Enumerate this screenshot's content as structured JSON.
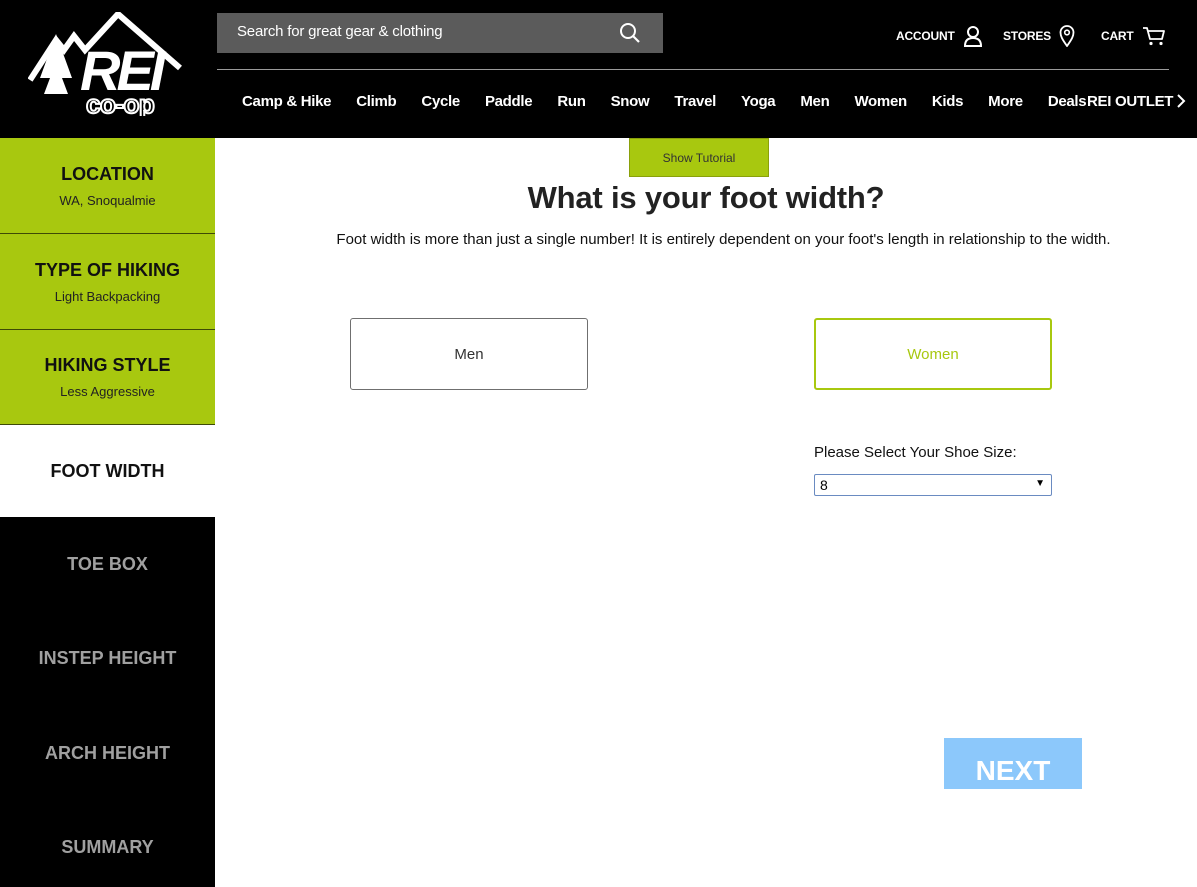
{
  "header": {
    "search_placeholder": "Search for great gear & clothing",
    "account_label": "ACCOUNT",
    "stores_label": "STORES",
    "cart_label": "CART",
    "nav": [
      "Camp & Hike",
      "Climb",
      "Cycle",
      "Paddle",
      "Run",
      "Snow",
      "Travel",
      "Yoga",
      "Men",
      "Women",
      "Kids",
      "More",
      "Deals"
    ],
    "outlet_label": "REI OUTLET"
  },
  "sidebar": {
    "steps": [
      {
        "title": "LOCATION",
        "subtitle": "WA, Snoqualmie",
        "state": "done"
      },
      {
        "title": "TYPE OF HIKING",
        "subtitle": "Light Backpacking",
        "state": "done"
      },
      {
        "title": "HIKING STYLE",
        "subtitle": "Less Aggressive",
        "state": "done"
      },
      {
        "title": "FOOT WIDTH",
        "subtitle": "",
        "state": "active"
      },
      {
        "title": "TOE BOX",
        "subtitle": "",
        "state": "future"
      },
      {
        "title": "INSTEP HEIGHT",
        "subtitle": "",
        "state": "future"
      },
      {
        "title": "ARCH HEIGHT",
        "subtitle": "",
        "state": "future"
      },
      {
        "title": "SUMMARY",
        "subtitle": "",
        "state": "future"
      }
    ]
  },
  "main": {
    "tutorial_label": "Show Tutorial",
    "title": "What is your foot width?",
    "description": "Foot width is more than just a single number! It is entirely dependent on your foot's length in relationship to the width.",
    "gender_options": [
      "Men",
      "Women"
    ],
    "selected_gender": "Women",
    "size_label": "Please Select Your Shoe Size:",
    "size_value": "8",
    "next_label": "NEXT"
  },
  "colors": {
    "brand_green": "#a8c80f",
    "next_blue": "#8cc8fb",
    "header_bg": "#000000"
  }
}
